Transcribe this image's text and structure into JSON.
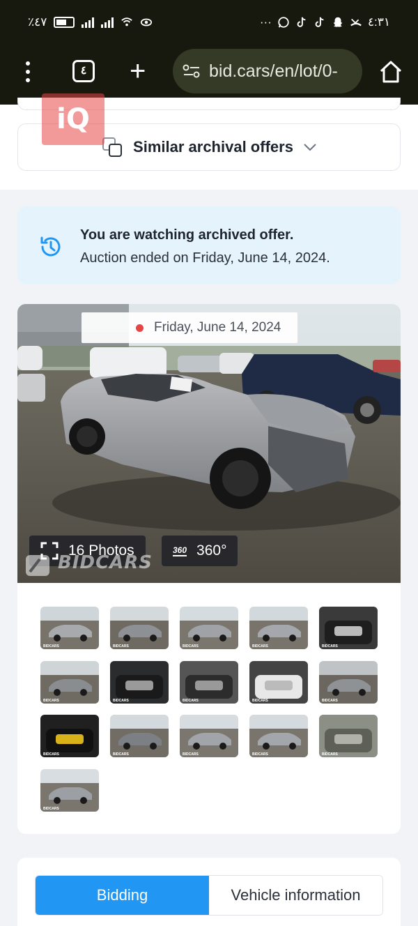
{
  "status_bar": {
    "battery_text": "٪٤٧",
    "time": "٤:٣١",
    "dots": "···"
  },
  "browser": {
    "tab_count": "٤",
    "url": "bid.cars/en/lot/0-"
  },
  "similar": {
    "label": "Similar archival offers"
  },
  "brand_overlay": "iQ",
  "notice": {
    "title": "You are watching archived offer.",
    "subtitle": "Auction ended on Friday, June 14, 2024."
  },
  "gallery": {
    "date": "Friday, June 14, 2024",
    "photos_label": "16 Photos",
    "view360_label": "360°",
    "view360_badge": "360",
    "watermark": "BIDCARS",
    "thumb_watermark": "BIDCARS",
    "thumbnails": [
      {
        "name": "thumb-1",
        "kind": "exterior-front-left"
      },
      {
        "name": "thumb-2",
        "kind": "exterior-front-damage"
      },
      {
        "name": "thumb-3",
        "kind": "exterior-side"
      },
      {
        "name": "thumb-4",
        "kind": "exterior-rear"
      },
      {
        "name": "thumb-5",
        "kind": "interior-seats"
      },
      {
        "name": "thumb-6",
        "kind": "exterior-damage-closeup"
      },
      {
        "name": "thumb-7",
        "kind": "dashboard-cluster"
      },
      {
        "name": "thumb-8",
        "kind": "interior-rear-seats"
      },
      {
        "name": "thumb-9",
        "kind": "door-label"
      },
      {
        "name": "thumb-10",
        "kind": "hood-damage"
      },
      {
        "name": "thumb-11",
        "kind": "center-console"
      },
      {
        "name": "thumb-12",
        "kind": "exterior-front"
      },
      {
        "name": "thumb-13",
        "kind": "exterior-side-right"
      },
      {
        "name": "thumb-14",
        "kind": "exterior-rear-right"
      },
      {
        "name": "thumb-15",
        "kind": "interior-dash"
      },
      {
        "name": "thumb-16",
        "kind": "exterior-rear-view"
      }
    ]
  },
  "tabs": [
    {
      "label": "Bidding",
      "active": true
    },
    {
      "label": "Vehicle information",
      "active": false
    }
  ],
  "colors": {
    "accent": "#2196f3",
    "notice_bg": "#e4f3fc",
    "live_dot": "#e94444"
  }
}
